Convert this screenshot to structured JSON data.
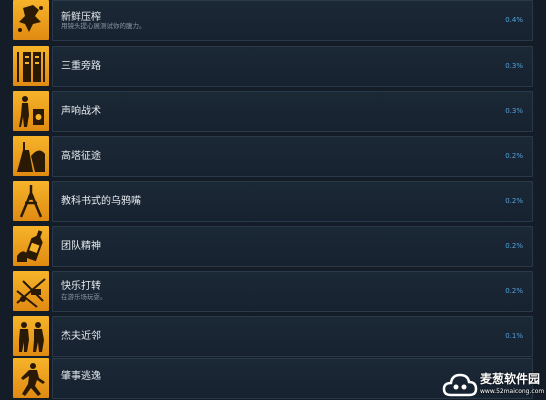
{
  "achievements": [
    {
      "title": "新鲜压榨",
      "description": "用镜头提心展测试你的腹力。",
      "percent": "0.4%",
      "icon": "splatter-icon"
    },
    {
      "title": "三重旁路",
      "description": "",
      "percent": "0.3%",
      "icon": "lockers-icon"
    },
    {
      "title": "声响战术",
      "description": "",
      "percent": "0.3%",
      "icon": "speaker-man-icon"
    },
    {
      "title": "高塔征途",
      "description": "",
      "percent": "0.2%",
      "icon": "tower-icon"
    },
    {
      "title": "教科书式的乌鸦嘴",
      "description": "",
      "percent": "0.2%",
      "icon": "dangling-figure-icon"
    },
    {
      "title": "团队精神",
      "description": "",
      "percent": "0.2%",
      "icon": "bottle-icon"
    },
    {
      "title": "快乐打转",
      "description": "在游乐场玩耍。",
      "percent": "0.2%",
      "icon": "ride-icon"
    },
    {
      "title": "杰夫近邻",
      "description": "",
      "percent": "0.1%",
      "icon": "two-figures-icon"
    },
    {
      "title": "肇事逃逸",
      "description": "",
      "percent": "",
      "icon": "running-figure-icon"
    }
  ],
  "watermark": {
    "name": "麦葱软件园",
    "url": "www.52maicong.com",
    "icon": "cloud-logo-icon"
  },
  "colors": {
    "background": "#141d27",
    "icon_gold": "#f6b42a",
    "percent_blue": "#52a3e0"
  }
}
